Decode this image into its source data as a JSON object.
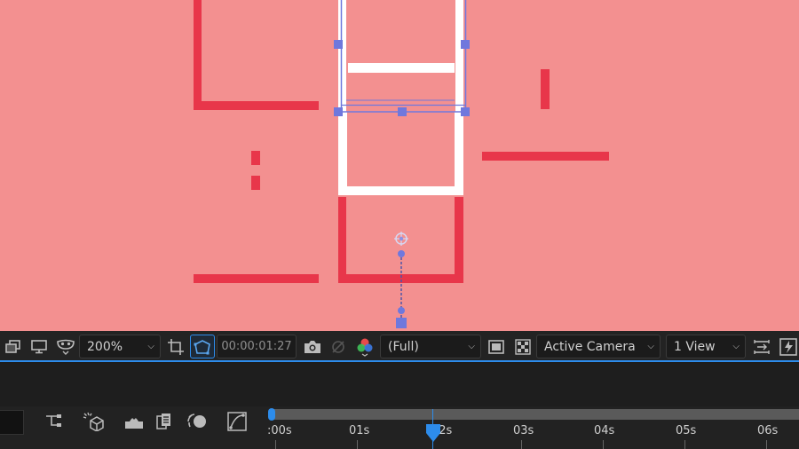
{
  "viewer": {
    "background": "#f39090",
    "accent_red": "#e8364a",
    "layer_white": "#ffffff",
    "handle_color": "#6f78dd"
  },
  "toolbar": {
    "icons": [
      "stack-icon",
      "monitor-icon",
      "mask-icon"
    ],
    "zoom_value": "200%",
    "region_icon": "region-of-interest-icon",
    "transparency_icon": "mask-path-icon",
    "timecode": "00:00:01:27",
    "snapshot_icon": "camera-icon",
    "show_snapshot_icon": "show-snapshot-icon",
    "channels_icon": "color-channels-icon",
    "resolution_value": "(Full)",
    "fast_preview_icon": "fast-preview-icon",
    "grid_icon": "transparency-grid-icon",
    "camera_value": "Active Camera",
    "views_value": "1 View",
    "accent": "#2d8ceb"
  },
  "timeline": {
    "ruler_labels": [
      ":00s",
      "01s",
      "02s",
      "03s",
      "04s",
      "05s",
      "06s"
    ],
    "current_time_label": "02s"
  }
}
